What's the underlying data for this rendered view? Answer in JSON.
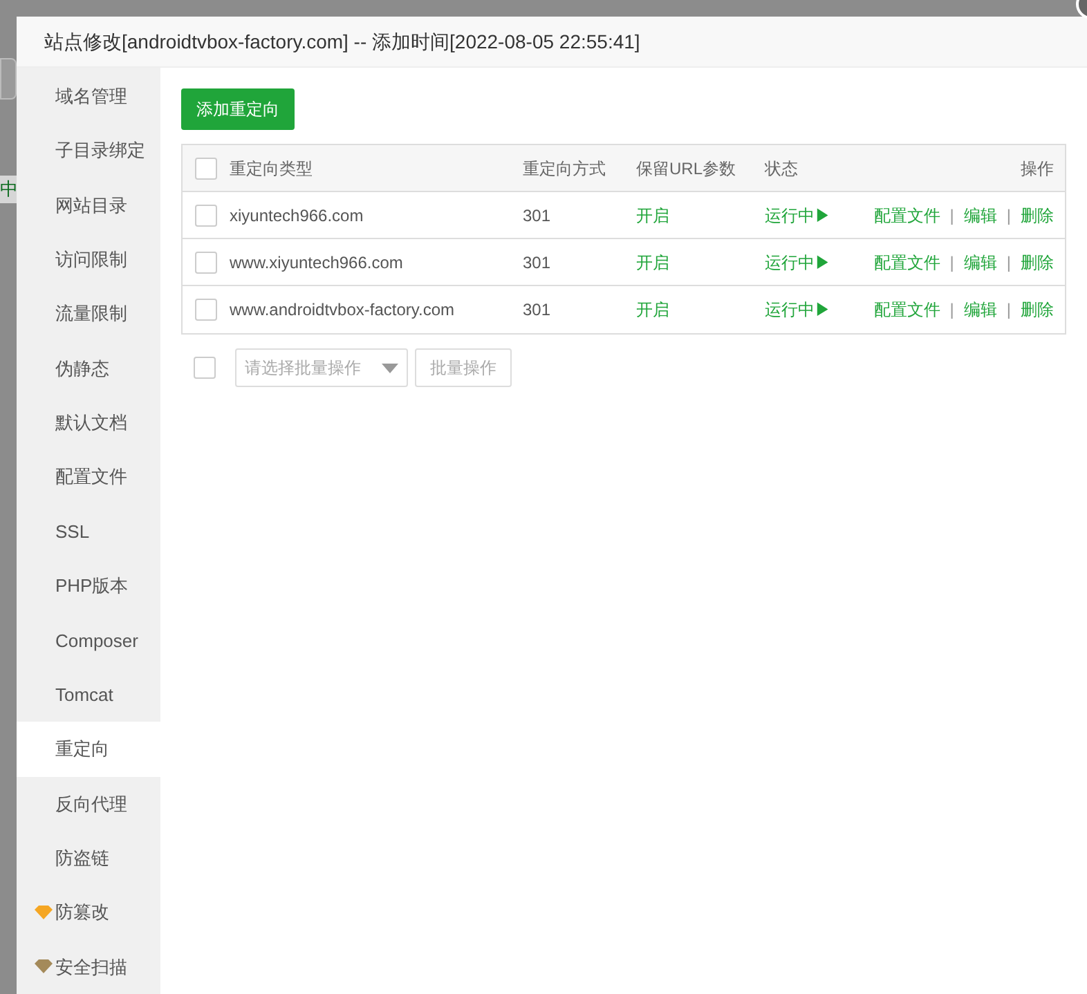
{
  "backdrop": {
    "status_fragment": "中"
  },
  "dialog": {
    "title": "站点修改[androidtvbox-factory.com] -- 添加时间[2022-08-05 22:55:41]"
  },
  "sidebar": {
    "items": [
      {
        "label": "域名管理",
        "selected": false
      },
      {
        "label": "子目录绑定",
        "selected": false
      },
      {
        "label": "网站目录",
        "selected": false
      },
      {
        "label": "访问限制",
        "selected": false
      },
      {
        "label": "流量限制",
        "selected": false
      },
      {
        "label": "伪静态",
        "selected": false
      },
      {
        "label": "默认文档",
        "selected": false
      },
      {
        "label": "配置文件",
        "selected": false
      },
      {
        "label": "SSL",
        "selected": false
      },
      {
        "label": "PHP版本",
        "selected": false
      },
      {
        "label": "Composer",
        "selected": false
      },
      {
        "label": "Tomcat",
        "selected": false
      },
      {
        "label": "重定向",
        "selected": true
      },
      {
        "label": "反向代理",
        "selected": false
      },
      {
        "label": "防盗链",
        "selected": false
      },
      {
        "label": "防篡改",
        "selected": false,
        "color": "#f5a623"
      },
      {
        "label": "安全扫描",
        "selected": false,
        "color": "#a48a5a"
      }
    ]
  },
  "add_button": "添加重定向",
  "table": {
    "all_checked": false,
    "columns": [
      "重定向类型",
      "重定向方式",
      "保留URL参数",
      "状态",
      "操作"
    ],
    "rows": [
      {
        "checked": false,
        "type": "xiyuntech966.com",
        "method": "301",
        "keep_params": "开启",
        "status": "运行中▶",
        "actions": [
          "配置文件",
          "|",
          "编辑",
          "|",
          "删除"
        ]
      },
      {
        "checked": false,
        "type": "www.xiyuntech966.com",
        "method": "301",
        "keep_params": "开启",
        "status": "运行中▶",
        "actions": [
          "配置文件",
          "|",
          "编辑",
          "|",
          "删除"
        ]
      },
      {
        "checked": false,
        "type": "www.androidtvbox-factory.com",
        "method": "301",
        "keep_params": "开启",
        "status": "运行中▶",
        "actions": [
          "配置文件",
          "|",
          "编辑",
          "|",
          "删除"
        ]
      }
    ]
  },
  "batch": {
    "checked": false,
    "select_placeholder": "请选择批量操作",
    "button": "批量操作"
  }
}
